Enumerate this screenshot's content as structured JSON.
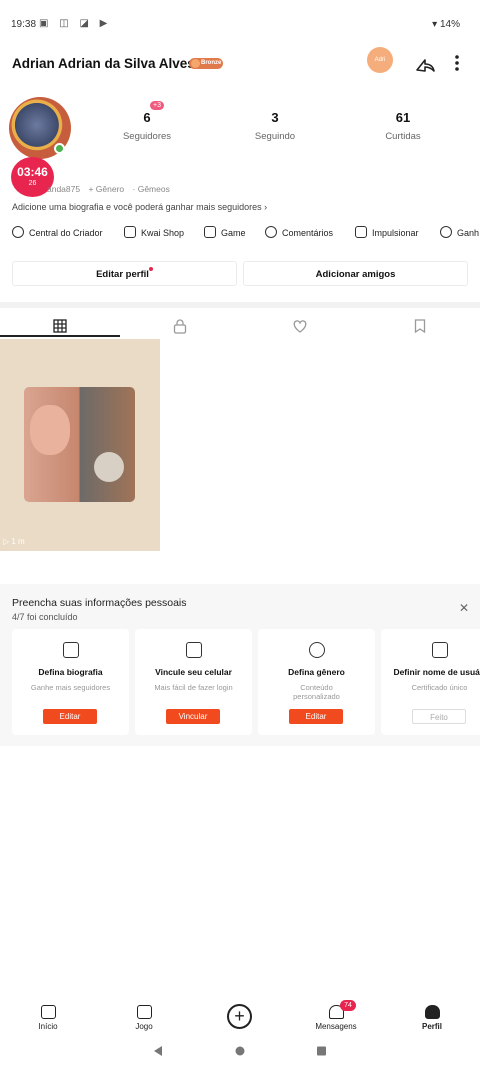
{
  "status_bar": {
    "time": "19:38",
    "battery": "14%"
  },
  "header": {
    "name": "Adrian Adrian da Silva Alves",
    "badge": "Bronze",
    "header_avatar_text": "Adri"
  },
  "profile": {
    "timer": "03:46",
    "coins": "26",
    "followers_delta": "+3",
    "stats": [
      {
        "value": "6",
        "label": "Seguidores"
      },
      {
        "value": "3",
        "label": "Seguindo"
      },
      {
        "value": "61",
        "label": "Curtidas"
      }
    ],
    "meta_id": "anda875",
    "meta_gender": "+ Gênero",
    "meta_gemini": "· Gêmeos",
    "bio": "Adicione uma biografia e você poderá ganhar mais seguidores  ›"
  },
  "shortcuts": [
    "Central do Criador",
    "Kwai Shop",
    "Game",
    "Comentários",
    "Impulsionar",
    "Ganh"
  ],
  "actions": {
    "edit": "Editar perfil",
    "add": "Adicionar amigos"
  },
  "video": {
    "duration": "1 m"
  },
  "info_panel": {
    "title": "Preencha suas informações pessoais",
    "progress": "4/7 foi concluído",
    "cards": [
      {
        "title": "Defina biografia",
        "sub": "Ganhe mais seguidores",
        "button": "Editar"
      },
      {
        "title": "Vincule seu celular",
        "sub": "Mais fácil de fazer login",
        "button": "Vincular"
      },
      {
        "title": "Defina gênero",
        "sub": "Conteúdo personalizado",
        "button": "Editar"
      },
      {
        "title": "Definir nome de usuári",
        "sub": "Certificado único",
        "button": "Feito"
      }
    ]
  },
  "bottom_nav": {
    "items": [
      "Início",
      "Jogo",
      "Mensagens",
      "Perfil"
    ],
    "messages_badge": "74"
  }
}
